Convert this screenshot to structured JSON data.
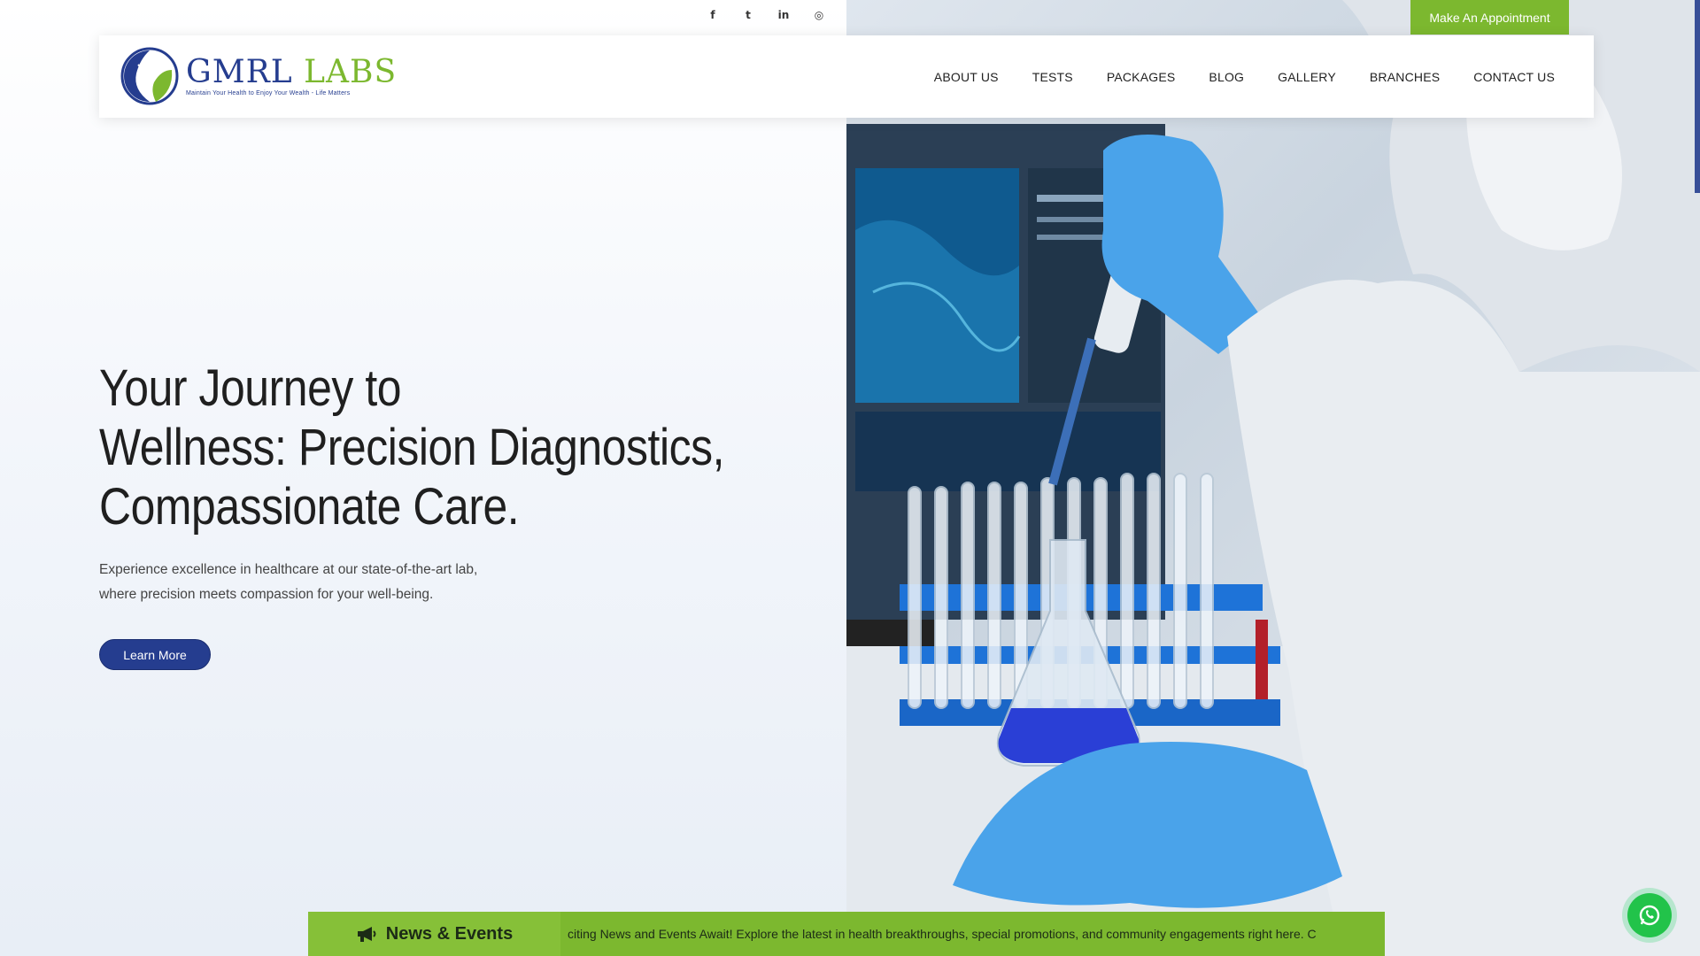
{
  "social": {
    "icons": [
      "facebook-icon",
      "twitter-icon",
      "linkedin-icon",
      "instagram-icon"
    ],
    "glyphs": [
      "f",
      "t",
      "in",
      "◎"
    ]
  },
  "appointment": {
    "label": "Make An Appointment"
  },
  "logo": {
    "brand_first": "GMRL",
    "brand_second": "LABS",
    "tagline": "Maintain Your Health to Enjoy Your Wealth - Life Matters"
  },
  "nav": {
    "items": [
      "ABOUT US",
      "TESTS",
      "PACKAGES",
      "BLOG",
      "GALLERY",
      "BRANCHES",
      "CONTACT US"
    ]
  },
  "hero": {
    "title_line1": "Your Journey to",
    "title_line2": "Wellness: Precision Diagnostics,",
    "title_line3": "Compassionate Care.",
    "desc_line1": "Experience excellence in healthcare at our state-of-the-art lab,",
    "desc_line2": "where precision meets compassion for your well-being.",
    "button": "Learn More"
  },
  "ticker": {
    "label": "News & Events",
    "text": "citing News and Events Await! Explore the latest in health breakthroughs, special promotions, and community engagements right here. C"
  },
  "colors": {
    "brand_blue": "#253d8f",
    "brand_green": "#7cb82f",
    "whatsapp": "#22c34a"
  }
}
